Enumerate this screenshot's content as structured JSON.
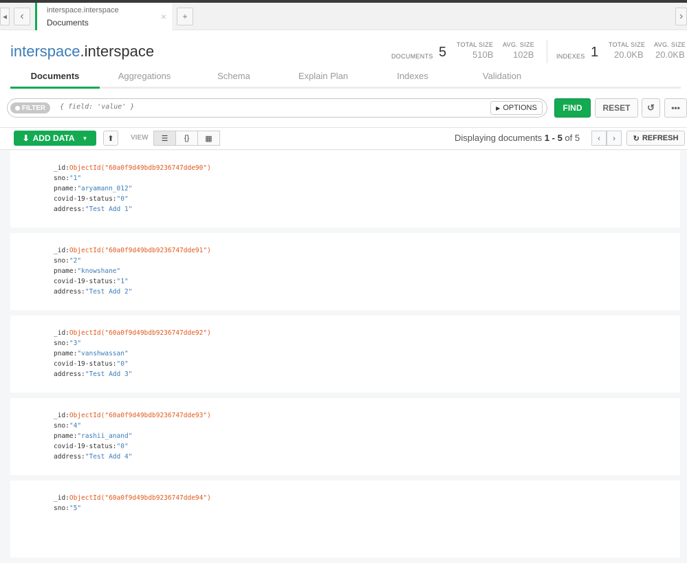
{
  "window": {
    "tab": {
      "line1": "interspace.interspace",
      "line2": "Documents",
      "close": "×"
    },
    "new_tab": "+",
    "back": "‹",
    "forward": "›",
    "left_arrow": "◂"
  },
  "header": {
    "db": "interspace",
    "collection": ".interspace",
    "stats": {
      "documents_label": "DOCUMENTS",
      "documents_count": "5",
      "total_size_label": "TOTAL SIZE",
      "total_size": "510B",
      "avg_size_label": "AVG. SIZE",
      "avg_size": "102B",
      "indexes_label": "INDEXES",
      "indexes_count": "1",
      "idx_total_size_label": "TOTAL SIZE",
      "idx_total_size": "20.0KB",
      "idx_avg_size_label": "AVG. SIZE",
      "idx_avg_size": "20.0KB"
    },
    "tabs": [
      "Documents",
      "Aggregations",
      "Schema",
      "Explain Plan",
      "Indexes",
      "Validation"
    ]
  },
  "filter": {
    "pill": "FILTER",
    "placeholder": "{ field: 'value' }",
    "options": "OPTIONS",
    "find": "FIND",
    "reset": "RESET"
  },
  "toolbar": {
    "add_data": "ADD DATA",
    "view_label": "VIEW",
    "displaying_prefix": "Displaying documents ",
    "range": "1 - 5",
    "of": " of 5",
    "refresh": "REFRESH"
  },
  "documents": [
    {
      "id": "ObjectId(\"60a0f9d49bdb9236747dde90\")",
      "sno": "\"1\"",
      "pname": "\"aryamann_012\"",
      "covid": "\"0\"",
      "address": "\"Test Add 1\""
    },
    {
      "id": "ObjectId(\"60a0f9d49bdb9236747dde91\")",
      "sno": "\"2\"",
      "pname": "\"knowshane\"",
      "covid": "\"1\"",
      "address": "\"Test Add 2\""
    },
    {
      "id": "ObjectId(\"60a0f9d49bdb9236747dde92\")",
      "sno": "\"3\"",
      "pname": "\"vanshwassan\"",
      "covid": "\"0\"",
      "address": "\"Test Add 3\""
    },
    {
      "id": "ObjectId(\"60a0f9d49bdb9236747dde93\")",
      "sno": "\"4\"",
      "pname": "\"rashii_anand\"",
      "covid": "\"0\"",
      "address": "\"Test Add 4\""
    },
    {
      "id": "ObjectId(\"60a0f9d49bdb9236747dde94\")",
      "sno": "\"5\"",
      "pname": "",
      "covid": "",
      "address": ""
    }
  ],
  "field_keys": {
    "id": "_id:",
    "sno": "sno:",
    "pname": "pname:",
    "covid": "covid-19-status:",
    "address": "address:"
  }
}
